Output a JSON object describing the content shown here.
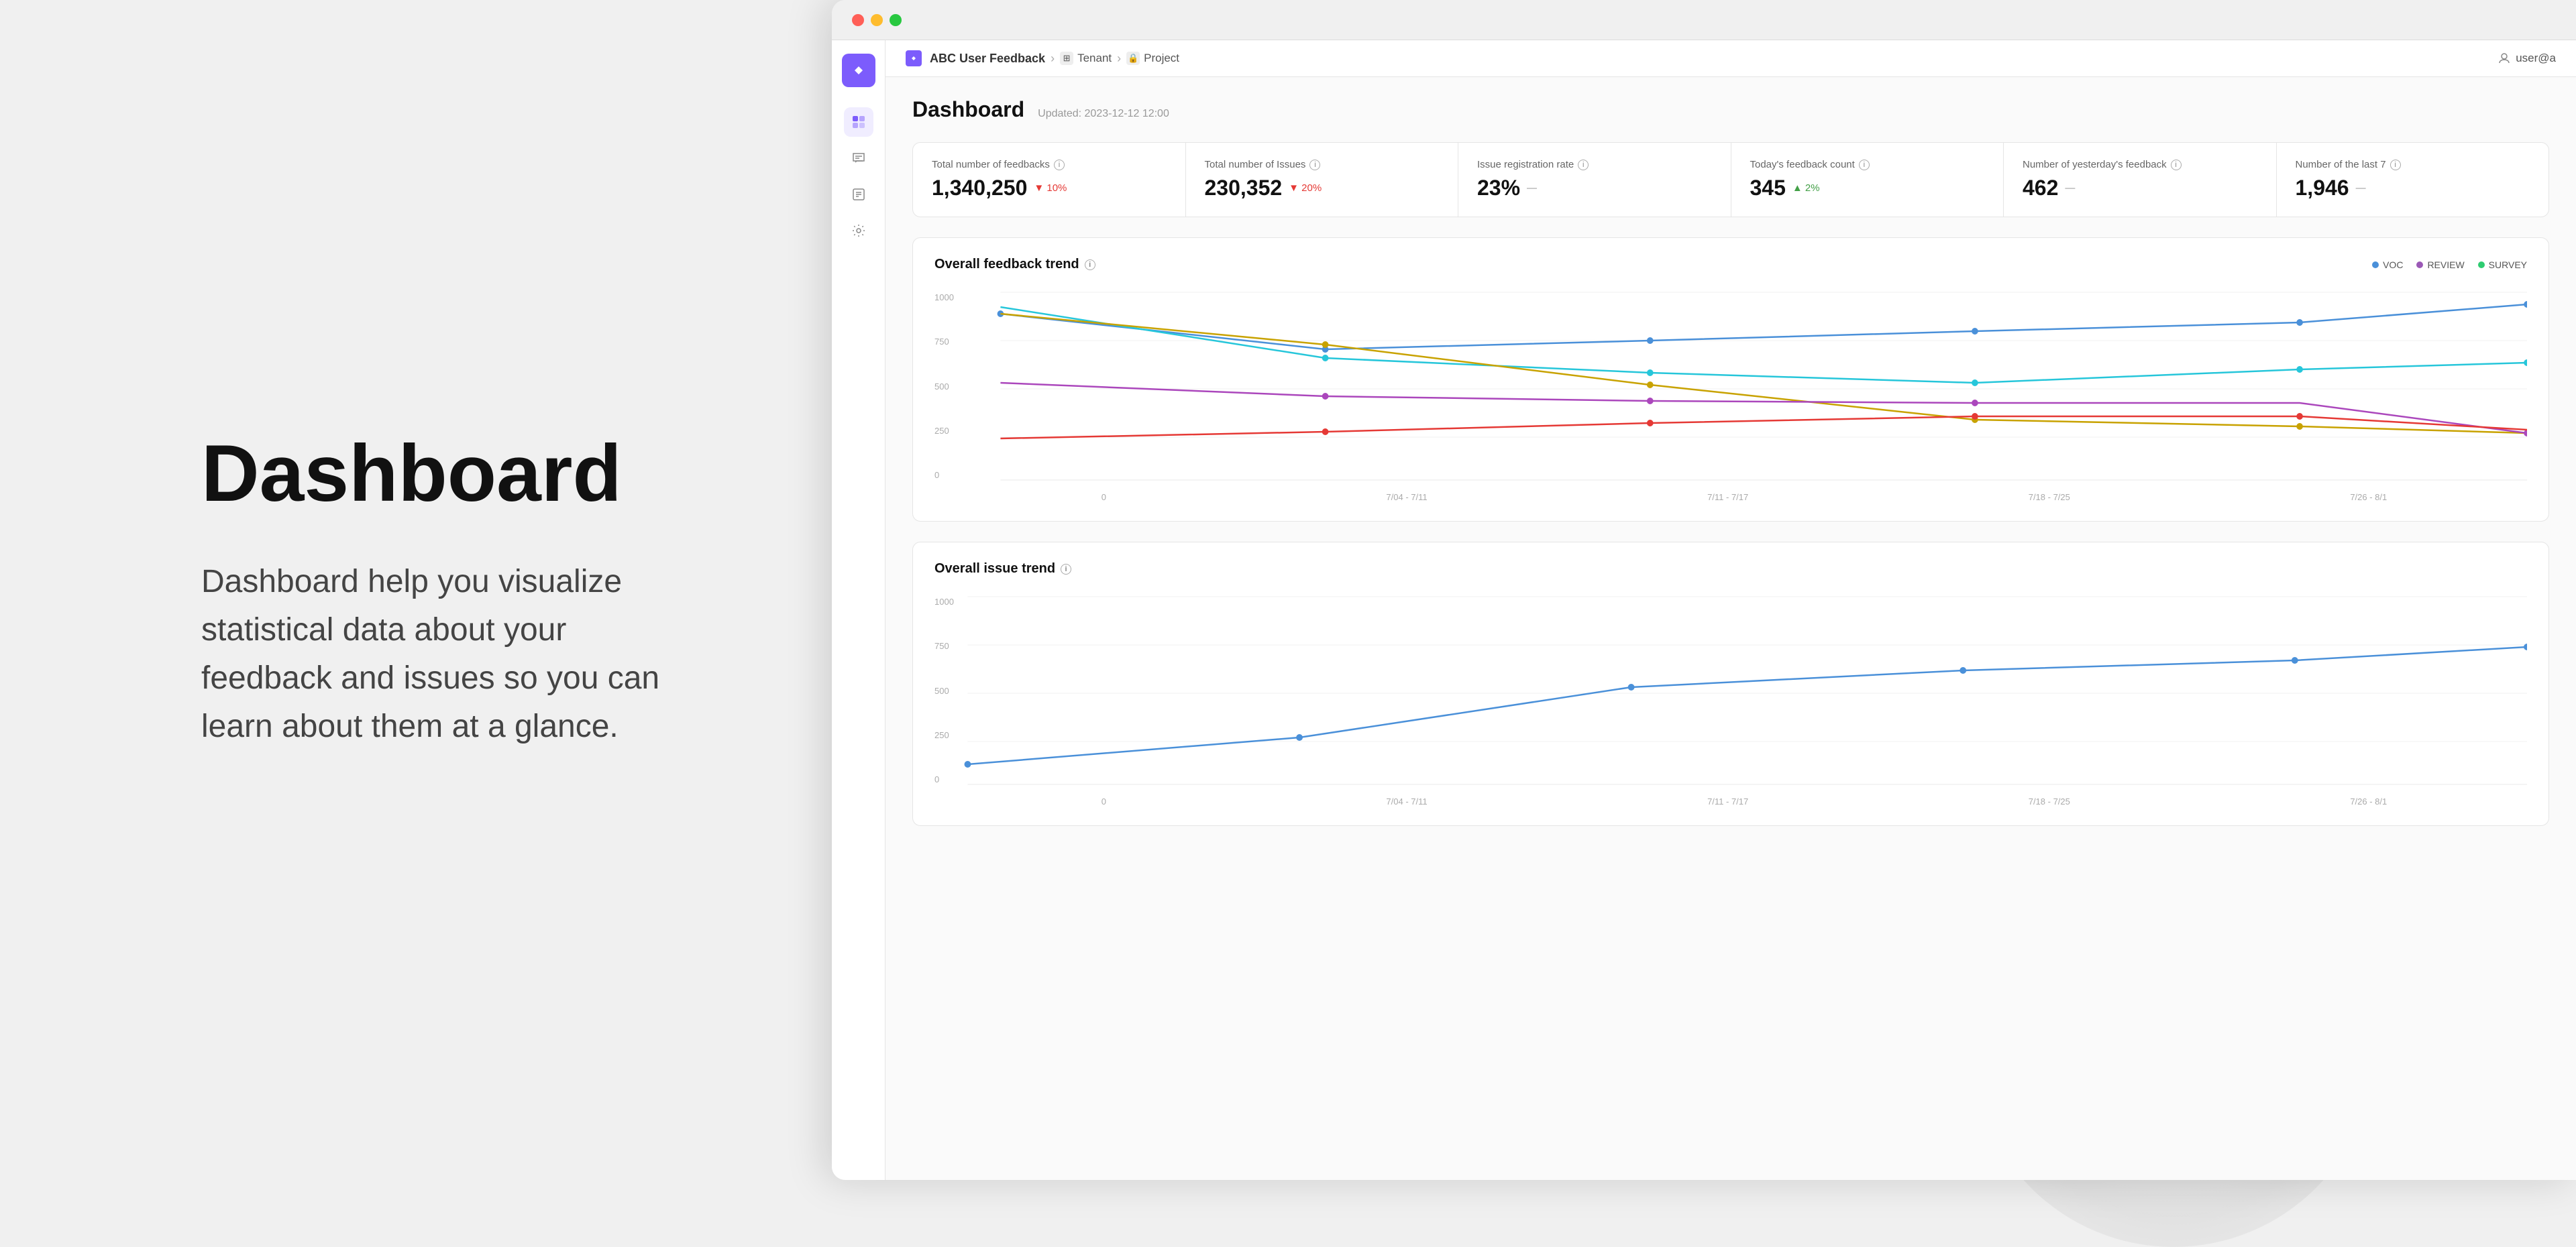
{
  "app": {
    "title": "ABC User Feedback",
    "updated": "Updated: 2023-12-12 12:00",
    "breadcrumb": {
      "tenant": "Tenant",
      "project": "Project"
    },
    "user": "user@a"
  },
  "left_panel": {
    "title": "Dashboard",
    "description": "Dashboard help you visualize statistical data about your feedback and issues so you can learn about them at a glance."
  },
  "page": {
    "title": "Dashboard"
  },
  "stats": [
    {
      "label": "Total number of feedbacks",
      "value": "1,340,250",
      "badge": "▼ 10%",
      "badge_type": "down"
    },
    {
      "label": "Total number of Issues",
      "value": "230,352",
      "badge": "▼ 20%",
      "badge_type": "down"
    },
    {
      "label": "Issue registration rate",
      "value": "23%",
      "badge": "—",
      "badge_type": "neutral"
    },
    {
      "label": "Today's feedback count",
      "value": "345",
      "badge": "▲ 2%",
      "badge_type": "up"
    },
    {
      "label": "Number of yesterday's feedback",
      "value": "462",
      "badge": "—",
      "badge_type": "neutral"
    },
    {
      "label": "Number of the last 7",
      "value": "1,946",
      "badge": "—",
      "badge_type": "neutral"
    }
  ],
  "charts": {
    "feedback_trend": {
      "title": "Overall feedback trend",
      "legend": [
        {
          "label": "VOC",
          "color": "#4a90d9"
        },
        {
          "label": "REVIEW",
          "color": "#9b59b6"
        },
        {
          "label": "SURVEY",
          "color": "#2ecc71"
        }
      ],
      "x_labels": [
        "0",
        "7/04 - 7/11",
        "7/11 - 7/17",
        "7/18 - 7/25",
        "7/26 - 8/1"
      ],
      "y_labels": [
        "1000",
        "750",
        "500",
        "250",
        "0"
      ]
    },
    "issue_trend": {
      "title": "Overall issue trend",
      "x_labels": [
        "0",
        "7/04 - 7/11",
        "7/11 - 7/17",
        "7/18 - 7/25",
        "7/26 - 8/1"
      ],
      "y_labels": [
        "1000",
        "750",
        "500",
        "250",
        "0"
      ]
    }
  },
  "traffic_lights": {
    "red": "#ff5f57",
    "yellow": "#febc2e",
    "green": "#28c840"
  },
  "sidebar": {
    "icons": [
      {
        "name": "dashboard-icon",
        "symbol": "⊞",
        "active": true
      },
      {
        "name": "feedback-icon",
        "symbol": "💬",
        "active": false
      },
      {
        "name": "issues-icon",
        "symbol": "📋",
        "active": false
      },
      {
        "name": "settings-icon",
        "symbol": "⚙",
        "active": false
      }
    ]
  }
}
